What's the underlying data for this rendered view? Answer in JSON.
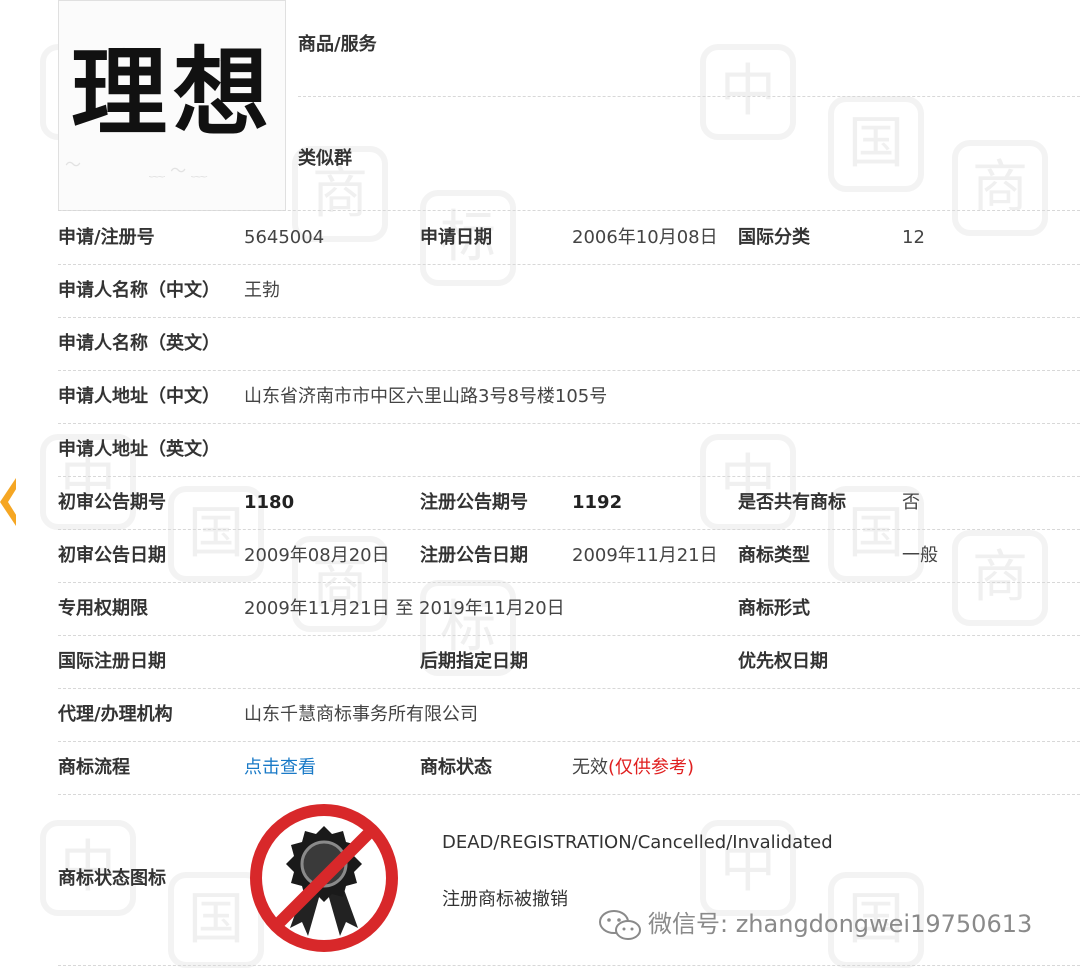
{
  "trademark": {
    "logo_text": "理想",
    "goods_label": "商品/服务",
    "similar_label": "类似群"
  },
  "rows": {
    "r1": {
      "app_no_label": "申请/注册号",
      "app_no": "5645004",
      "app_date_label": "申请日期",
      "app_date": "2006年10月08日",
      "intl_class_label": "国际分类",
      "intl_class": "12"
    },
    "r2": {
      "label": "申请人名称（中文）",
      "value": "王勃"
    },
    "r3": {
      "label": "申请人名称（英文）",
      "value": ""
    },
    "r4": {
      "label": "申请人地址（中文）",
      "value": "山东省济南市市中区六里山路3号8号楼105号"
    },
    "r5": {
      "label": "申请人地址（英文）",
      "value": ""
    },
    "r6": {
      "prelim_no_label": "初审公告期号",
      "prelim_no": "1180",
      "reg_no_label": "注册公告期号",
      "reg_no": "1192",
      "shared_label": "是否共有商标",
      "shared": "否"
    },
    "r7": {
      "prelim_date_label": "初审公告日期",
      "prelim_date": "2009年08月20日",
      "reg_date_label": "注册公告日期",
      "reg_date": "2009年11月21日",
      "tm_type_label": "商标类型",
      "tm_type": "一般"
    },
    "r8": {
      "term_label": "专用权期限",
      "term": "2009年11月21日 至 2019年11月20日",
      "form_label": "商标形式",
      "form": ""
    },
    "r9": {
      "intl_reg_label": "国际注册日期",
      "intl_reg": "",
      "later_label": "后期指定日期",
      "later": "",
      "priority_label": "优先权日期",
      "priority": ""
    },
    "r10": {
      "label": "代理/办理机构",
      "value": "山东千慧商标事务所有限公司"
    },
    "r11": {
      "process_label": "商标流程",
      "process_link": "点击查看",
      "status_label": "商标状态",
      "status": "无效",
      "status_note": "(仅供参考)"
    }
  },
  "status_icon": {
    "label": "商标状态图标",
    "english": "DEAD/REGISTRATION/Cancelled/Invalidated",
    "chinese": "注册商标被撤销"
  },
  "watermark": {
    "text": "微信号: zhangdongwei19750613"
  },
  "colors": {
    "link": "#1a7ac7",
    "reference_note": "#e02020",
    "prohibition": "#d8282a",
    "accent_chevron": "#f5a623"
  }
}
